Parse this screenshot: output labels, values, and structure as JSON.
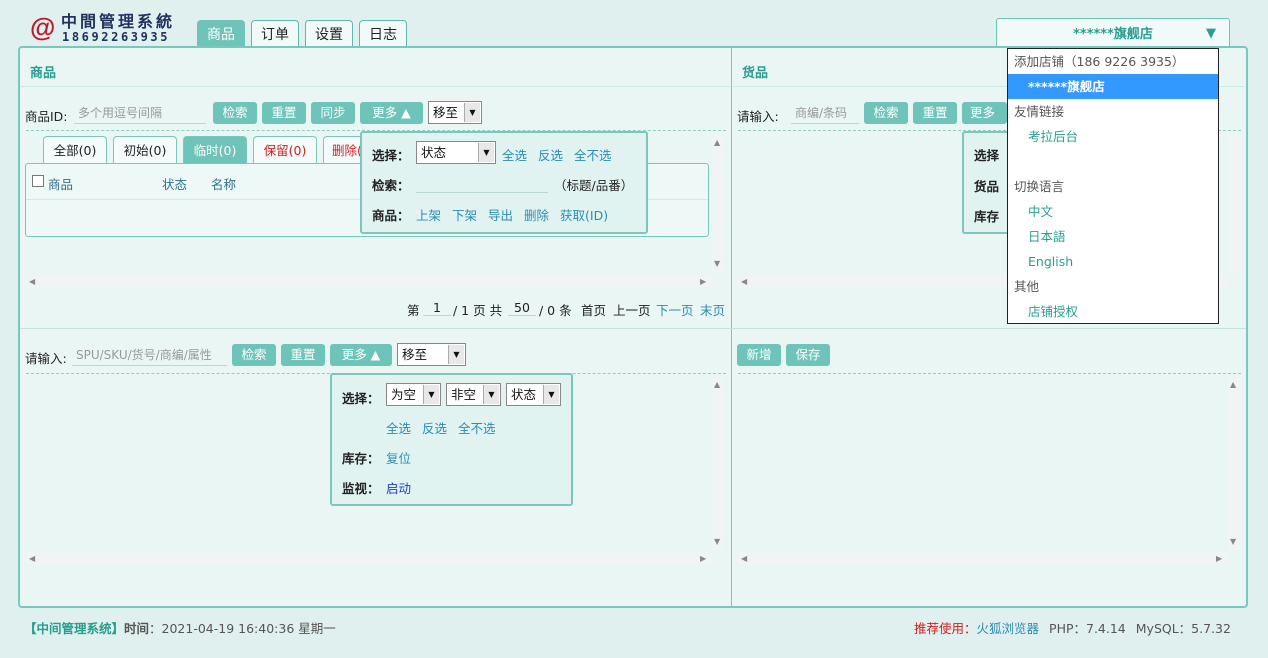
{
  "logo": {
    "at": "@",
    "title": "中間管理系統",
    "phone": "18692263935"
  },
  "tabs": [
    {
      "label": "商品"
    },
    {
      "label": "订单"
    },
    {
      "label": "设置"
    },
    {
      "label": "日志"
    }
  ],
  "store_selector": {
    "value": "******旗舰店",
    "arrow": "▼"
  },
  "goods": {
    "title": "商品",
    "id_label": "商品ID:",
    "id_placeholder": "多个用逗号间隔",
    "search": "检索",
    "reset": "重置",
    "sync": "同步",
    "more": "更多 ▲",
    "move_to": "移至",
    "filter_tabs": [
      {
        "label": "全部(0)"
      },
      {
        "label": "初始(0)"
      },
      {
        "label": "临时(0)"
      },
      {
        "label": "保留(0)"
      },
      {
        "label": "删除("
      }
    ],
    "columns": [
      "商品",
      "状态",
      "名称"
    ],
    "popup": {
      "select_label": "选择：",
      "status": "状态",
      "select_all": "全选",
      "invert": "反选",
      "select_none": "全不选",
      "search_label": "检索：",
      "search_hint": "（标题/品番）",
      "goods_label": "商品：",
      "actions": [
        "上架",
        "下架",
        "导出",
        "删除",
        "获取(ID)"
      ]
    },
    "pager": {
      "page_prefix": "第",
      "page": "1",
      "page_sep": "/ 1 页 共",
      "page_size": "50",
      "count_text": "/ 0 条",
      "first": "首页",
      "prev": "上一页",
      "next": "下一页",
      "last": "末页"
    }
  },
  "cargo": {
    "title": "货品",
    "input_label": "请输入:",
    "input_placeholder": "商编/条码",
    "search": "检索",
    "reset": "重置",
    "more": "更多 ▲",
    "popup": {
      "select_label": "选择",
      "cargo_label": "货品",
      "stock_label": "库存"
    }
  },
  "sku": {
    "input_label": "请输入:",
    "input_placeholder": "SPU/SKU/货号/商编/属性",
    "search": "检索",
    "reset": "重置",
    "more": "更多 ▲",
    "move_to": "移至",
    "popup": {
      "select_label": "选择：",
      "opt_empty": "为空",
      "opt_not_empty": "非空",
      "opt_status": "状态",
      "select_all": "全选",
      "invert": "反选",
      "select_none": "全不选",
      "stock_label": "库存：",
      "stock_action": "复位",
      "monitor_label": "监视：",
      "monitor_action": "启动"
    }
  },
  "editor": {
    "new": "新增",
    "save": "保存"
  },
  "dropdown": {
    "add_store": "添加店铺（186 9226 3935）",
    "selected_store": "******旗舰店",
    "friend_links": "友情链接",
    "link_kaola": "考拉后台",
    "lang_header": "切换语言",
    "lang_zh": "中文",
    "lang_ja": "日本語",
    "lang_en": "English",
    "other": "其他",
    "store_auth": "店铺授权"
  },
  "footer": {
    "system": "【中间管理系统】",
    "time_label": "时间",
    "time_value": "：2021-04-19 16:40:36 星期一",
    "recommend": "推荐使用：",
    "browser": "火狐浏览器",
    "php": "PHP：7.4.14",
    "mysql": "MySQL：5.7.32"
  },
  "colors": {
    "accent": "#6ec4b8",
    "link": "#2d8cb3",
    "background": "#dff0ee",
    "warning": "#d02020"
  }
}
